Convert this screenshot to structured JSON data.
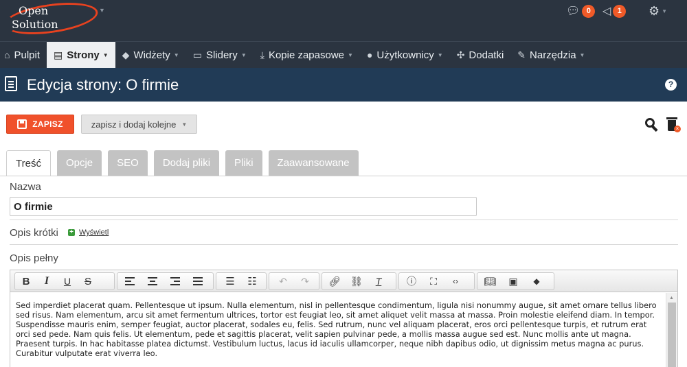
{
  "brand": {
    "line1": "Open",
    "line2": "Solution"
  },
  "header": {
    "notifications_count": "0",
    "messages_count": "1"
  },
  "nav": {
    "items": [
      {
        "label": "Pulpit",
        "icon": "home-icon",
        "dropdown": false,
        "active": false
      },
      {
        "label": "Strony",
        "icon": "page-icon",
        "dropdown": true,
        "active": true
      },
      {
        "label": "Widżety",
        "icon": "cube-icon",
        "dropdown": true,
        "active": false
      },
      {
        "label": "Slidery",
        "icon": "image-icon",
        "dropdown": true,
        "active": false
      },
      {
        "label": "Kopie zapasowe",
        "icon": "download-icon",
        "dropdown": true,
        "active": false
      },
      {
        "label": "Użytkownicy",
        "icon": "user-icon",
        "dropdown": true,
        "active": false
      },
      {
        "label": "Dodatki",
        "icon": "puzzle-icon",
        "dropdown": false,
        "active": false
      },
      {
        "label": "Narzędzia",
        "icon": "wrench-icon",
        "dropdown": true,
        "active": false
      }
    ]
  },
  "page": {
    "title": "Edycja strony: O firmie"
  },
  "actions": {
    "save_label": "ZAPISZ",
    "save_next_label": "zapisz i dodaj kolejne"
  },
  "tabs": [
    "Treść",
    "Opcje",
    "SEO",
    "Dodaj pliki",
    "Pliki",
    "Zaawansowane"
  ],
  "form": {
    "name_label": "Nazwa",
    "name_value": "O firmie",
    "short_desc_label": "Opis krótki",
    "show_link": "Wyświetl",
    "full_desc_label": "Opis pełny",
    "editor_content": "Sed imperdiet placerat quam. Pellentesque ut ipsum. Nulla elementum, nisl in pellentesque condimentum, ligula nisi nonummy augue, sit amet ornare tellus libero sed risus. Nam elementum, arcu sit amet fermentum ultrices, tortor est feugiat leo, sit amet aliquet velit massa at massa. Proin molestie eleifend diam. In tempor. Suspendisse mauris enim, semper feugiat, auctor placerat, sodales eu, felis. Sed rutrum, nunc vel aliquam placerat, eros orci pellentesque turpis, et rutrum erat orci sed pede. Nam quis felis. Ut elementum, pede et sagittis placerat, velit sapien pulvinar pede, a mollis massa augue sed est. Nunc mollis ante ut magna. Praesent turpis. In hac habitasse platea dictumst. Vestibulum luctus, lacus id iaculis ullamcorper, neque nibh dapibus odio, ut dignissim metus magna ac purus. Curabitur vulputate erat viverra leo."
  },
  "colors": {
    "header_bg": "#2b3440",
    "title_bg": "#213b56",
    "accent": "#f0512b"
  }
}
